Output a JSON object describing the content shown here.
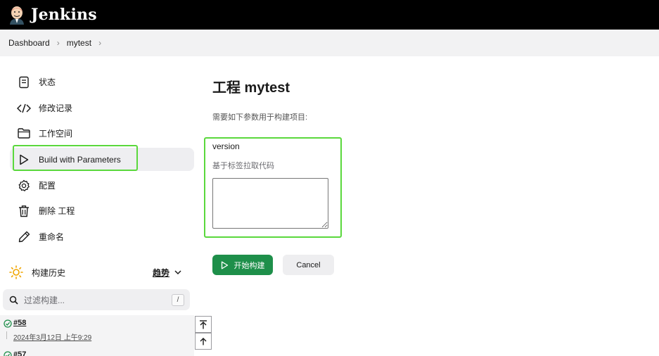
{
  "header": {
    "app_name": "Jenkins"
  },
  "breadcrumb": {
    "items": [
      "Dashboard",
      "mytest"
    ]
  },
  "sidebar": {
    "items": [
      {
        "label": "状态",
        "icon": "document-icon"
      },
      {
        "label": "修改记录",
        "icon": "code-icon"
      },
      {
        "label": "工作空间",
        "icon": "folder-icon"
      },
      {
        "label": "Build with Parameters",
        "icon": "play-icon"
      },
      {
        "label": "配置",
        "icon": "gear-icon"
      },
      {
        "label": "删除 工程",
        "icon": "trash-icon"
      },
      {
        "label": "重命名",
        "icon": "pencil-icon"
      }
    ]
  },
  "build_history": {
    "title": "构建历史",
    "trend_label": "趋势",
    "filter_placeholder": "过滤构建...",
    "filter_shortcut": "/",
    "builds": [
      {
        "number": "#58",
        "date": "2024年3月12日 上午9:29",
        "status": "success"
      },
      {
        "number": "#57",
        "status": "success"
      }
    ]
  },
  "main": {
    "title": "工程 mytest",
    "subtitle": "需要如下参数用于构建项目:",
    "parameter": {
      "name": "version",
      "description": "基于标签拉取代码",
      "value": ""
    },
    "build_button": "开始构建",
    "cancel_button": "Cancel"
  },
  "colors": {
    "header_bg": "#000000",
    "accent_green": "#1e8f4a",
    "highlight": "#5ad83c",
    "sun_orange": "#f0a500"
  }
}
